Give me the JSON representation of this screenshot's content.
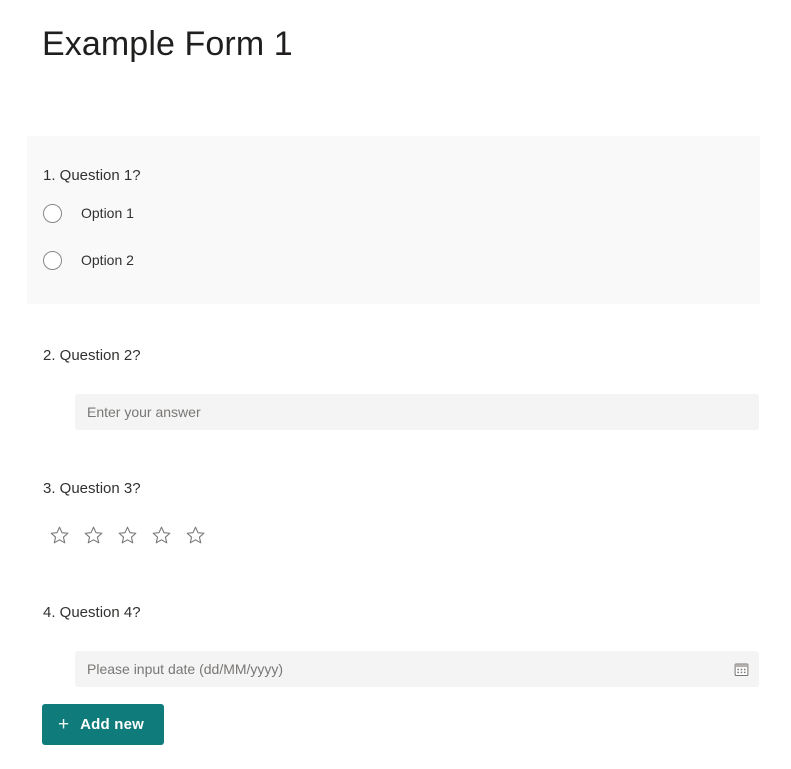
{
  "form": {
    "title": "Example Form 1"
  },
  "questions": [
    {
      "number": "1.",
      "title": "1. Question 1?",
      "type": "choice",
      "selected": true,
      "options": [
        {
          "label": "Option 1",
          "icon": "radio-unchecked-icon"
        },
        {
          "label": "Option 2",
          "icon": "radio-unchecked-icon"
        }
      ]
    },
    {
      "number": "2.",
      "title": "2. Question 2?",
      "type": "text",
      "selected": false,
      "input": {
        "value": "",
        "placeholder": "Enter your answer"
      }
    },
    {
      "number": "3.",
      "title": "3. Question 3?",
      "type": "rating",
      "selected": false,
      "rating": {
        "max": 5,
        "value": 0,
        "icon": "star-outline-icon"
      }
    },
    {
      "number": "4.",
      "title": "4. Question 4?",
      "type": "date",
      "selected": false,
      "input": {
        "value": "",
        "placeholder": "Please input date (dd/MM/yyyy)",
        "icon": "calendar-icon"
      }
    }
  ],
  "toolbar": {
    "add_new_label": "Add new",
    "add_new_icon": "plus-icon"
  },
  "colors": {
    "accent": "#0f7b7b",
    "selected_card_bg": "#f9f9f9",
    "input_bg": "#f4f4f4",
    "text": "#323130",
    "placeholder": "#797775",
    "star_stroke": "#797775",
    "radio_border": "#8a8886"
  }
}
